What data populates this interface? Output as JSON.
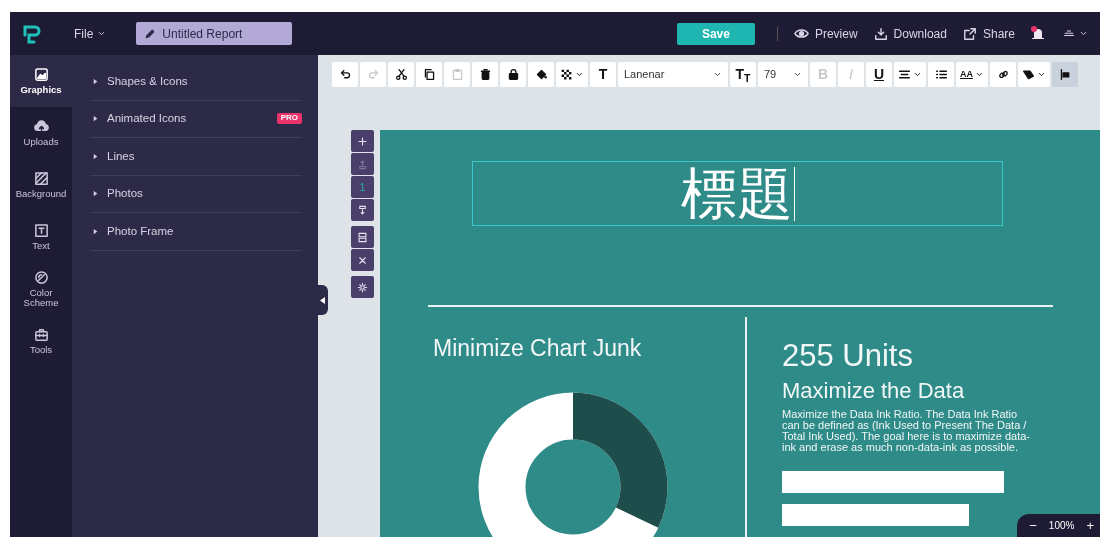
{
  "menu": {
    "label": "File"
  },
  "document_title": {
    "value": "Untitled Report"
  },
  "actions": [
    {
      "kind": "primary",
      "label": "Save"
    },
    {
      "kind": "link",
      "label": "Preview"
    },
    {
      "kind": "link",
      "label": "Download"
    },
    {
      "kind": "link",
      "label": "Share"
    }
  ],
  "notifications": {
    "unread": true
  },
  "rail": [
    {
      "label": "Graphics",
      "selected": true
    },
    {
      "label": "Uploads",
      "selected": false
    },
    {
      "label": "Background",
      "selected": false
    },
    {
      "label": "Text",
      "selected": false
    },
    {
      "label": "Color Scheme",
      "selected": false
    },
    {
      "label": "Tools",
      "selected": false
    }
  ],
  "panel_items": [
    {
      "label": "Shapes & Icons",
      "expanded": false
    },
    {
      "label": "Animated Icons",
      "expanded": false,
      "badge": "PRO"
    },
    {
      "label": "Lines",
      "expanded": false
    },
    {
      "label": "Photos",
      "expanded": false
    },
    {
      "label": "Photo Frame",
      "expanded": false
    }
  ],
  "toolbar": [
    {
      "kind": "icon",
      "disabled": false
    },
    {
      "kind": "icon",
      "disabled": true
    },
    {
      "kind": "icon",
      "disabled": false
    },
    {
      "kind": "icon",
      "disabled": false
    },
    {
      "kind": "icon",
      "disabled": true
    },
    {
      "kind": "icon",
      "disabled": false
    },
    {
      "kind": "icon",
      "disabled": false
    },
    {
      "kind": "icon",
      "disabled": false
    },
    {
      "kind": "icon",
      "disabled": false,
      "caret": true
    },
    {
      "kind": "text",
      "label": "T",
      "disabled": false
    },
    {
      "kind": "select",
      "value": "Lanenar"
    },
    {
      "kind": "text",
      "label": "T$_{T}$",
      "disabled": false
    },
    {
      "kind": "select",
      "value": "79"
    },
    {
      "kind": "text",
      "label": "B",
      "disabled": true
    },
    {
      "kind": "text",
      "label": "I",
      "disabled": true
    },
    {
      "kind": "text",
      "label": "U",
      "disabled": false
    },
    {
      "kind": "icon",
      "disabled": false,
      "caret": true
    },
    {
      "kind": "icon",
      "disabled": false
    },
    {
      "kind": "text",
      "label": "AA",
      "disabled": false,
      "caret": true
    },
    {
      "kind": "icon",
      "disabled": false
    },
    {
      "kind": "icon",
      "disabled": false,
      "caret": true
    },
    {
      "kind": "icon",
      "disabled": false,
      "selected": true
    }
  ],
  "page_controls": [
    {
      "kind": "icon",
      "disabled": false
    },
    {
      "kind": "icon",
      "disabled": true
    },
    {
      "kind": "number",
      "label": "1"
    },
    {
      "kind": "icon",
      "disabled": false
    },
    {
      "kind": "icon",
      "disabled": false
    },
    {
      "kind": "icon",
      "disabled": false
    },
    {
      "kind": "icon",
      "disabled": false
    }
  ],
  "canvas": {
    "title": "標題",
    "title_selected": true,
    "left_heading": "Minimize Chart Junk",
    "stat": "255 Units",
    "right_heading": "Maximize the Data",
    "paragraph": "Maximize the Data Ink Ratio. The Data Ink Ratio can be defined as (Ink Used to Present The Data / Total Ink Used). The goal here is to maximize data-ink and erase as much non-data-ink as possible."
  },
  "zoom": {
    "minus": "−",
    "value": "100%",
    "plus": "+"
  }
}
